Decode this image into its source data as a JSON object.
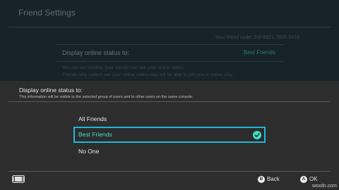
{
  "background": {
    "title": "Friend Settings",
    "friend_code": "Your friend code: SW-6621-7605-0419",
    "setting_label": "Display online status to:",
    "setting_value": "Best Friends",
    "description_line1": "You can set whether your friends can see your online status.",
    "description_line2": "Friends who cannot see your online status may not be able to join you in online play."
  },
  "dialog": {
    "title": "Display online status to:",
    "description": "This information will be visible to the selected group of users and to other users on the same console.",
    "options": [
      {
        "label": "All Friends",
        "selected": false
      },
      {
        "label": "Best Friends",
        "selected": true
      },
      {
        "label": "No One",
        "selected": false
      }
    ]
  },
  "footer": {
    "console_icon": "console-icon",
    "back_glyph": "B",
    "back_label": "Back",
    "ok_glyph": "A",
    "ok_label": "OK"
  },
  "watermark": "wsxdn.com",
  "colors": {
    "selection_border": "#21b6d8",
    "selected_text": "#3ce0c0",
    "dialog_bg": "#2d2d2d",
    "background": "#16242a"
  }
}
